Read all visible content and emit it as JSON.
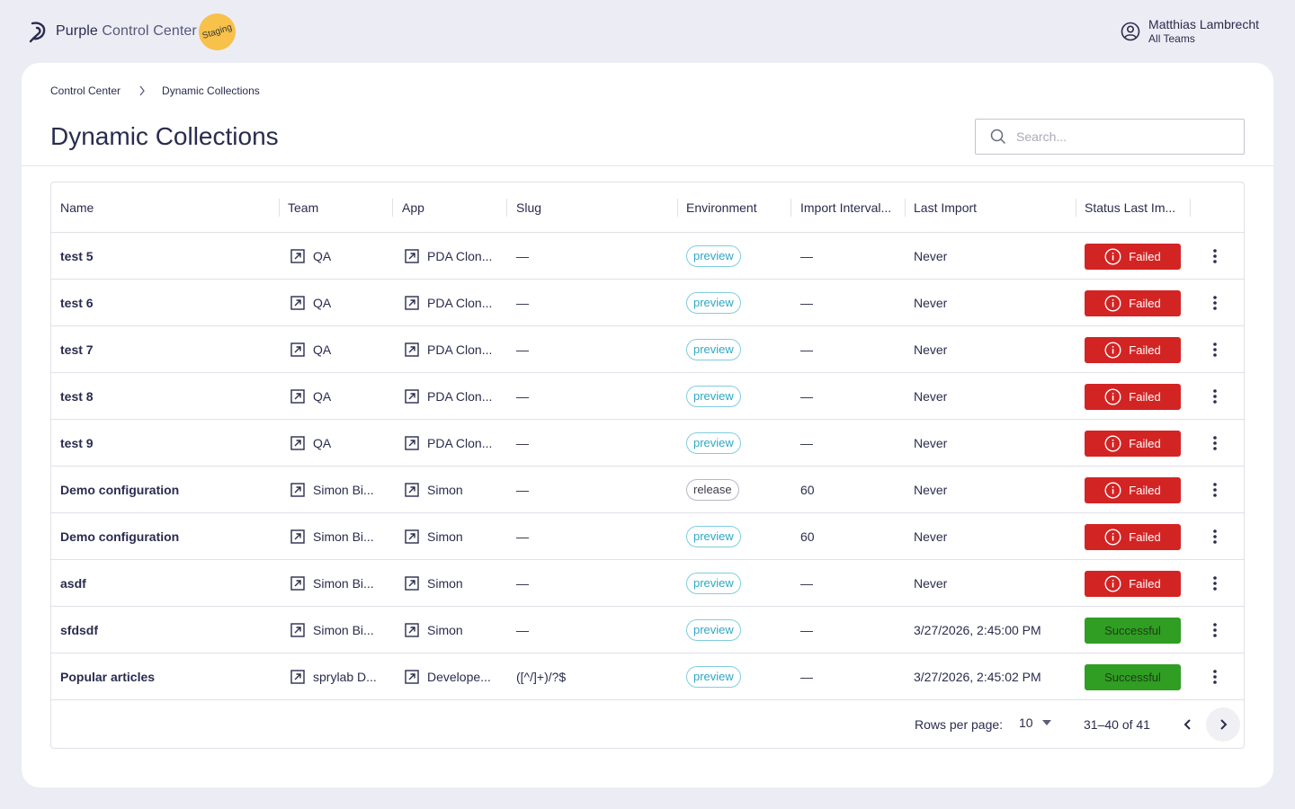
{
  "header": {
    "brand_strong": "Purple",
    "brand_light": "Control Center",
    "env_badge": "Staging",
    "user_name": "Matthias Lambrecht",
    "user_team": "All Teams"
  },
  "breadcrumb": {
    "root": "Control Center",
    "current": "Dynamic Collections"
  },
  "page": {
    "title": "Dynamic Collections",
    "search_placeholder": "Search..."
  },
  "table": {
    "columns": [
      "Name",
      "Team",
      "App",
      "Slug",
      "Environment",
      "Import Interval...",
      "Last Import",
      "Status Last Im..."
    ],
    "rows": [
      {
        "name": "test 5",
        "team": "QA",
        "app": "PDA Clon...",
        "slug": "—",
        "env": "preview",
        "interval": "—",
        "last": "Never",
        "status": "Failed"
      },
      {
        "name": "test 6",
        "team": "QA",
        "app": "PDA Clon...",
        "slug": "—",
        "env": "preview",
        "interval": "—",
        "last": "Never",
        "status": "Failed"
      },
      {
        "name": "test 7",
        "team": "QA",
        "app": "PDA Clon...",
        "slug": "—",
        "env": "preview",
        "interval": "—",
        "last": "Never",
        "status": "Failed"
      },
      {
        "name": "test 8",
        "team": "QA",
        "app": "PDA Clon...",
        "slug": "—",
        "env": "preview",
        "interval": "—",
        "last": "Never",
        "status": "Failed"
      },
      {
        "name": "test 9",
        "team": "QA",
        "app": "PDA Clon...",
        "slug": "—",
        "env": "preview",
        "interval": "—",
        "last": "Never",
        "status": "Failed"
      },
      {
        "name": "Demo configuration",
        "team": "Simon Bi...",
        "app": "Simon",
        "slug": "—",
        "env": "release",
        "interval": "60",
        "last": "Never",
        "status": "Failed"
      },
      {
        "name": "Demo configuration",
        "team": "Simon Bi...",
        "app": "Simon",
        "slug": "—",
        "env": "preview",
        "interval": "60",
        "last": "Never",
        "status": "Failed"
      },
      {
        "name": "asdf",
        "team": "Simon Bi...",
        "app": "Simon",
        "slug": "—",
        "env": "preview",
        "interval": "—",
        "last": "Never",
        "status": "Failed"
      },
      {
        "name": "sfdsdf",
        "team": "Simon Bi...",
        "app": "Simon",
        "slug": "—",
        "env": "preview",
        "interval": "—",
        "last": "3/27/2026, 2:45:00 PM",
        "status": "Successful"
      },
      {
        "name": "Popular articles",
        "team": "sprylab D...",
        "app": "Develope...",
        "slug": "([^/]+)/?$",
        "env": "preview",
        "interval": "—",
        "last": "3/27/2026, 2:45:02 PM",
        "status": "Successful"
      }
    ]
  },
  "pagination": {
    "rows_per_page_label": "Rows per page:",
    "rows_per_page_value": "10",
    "range_text": "31–40 of 41"
  },
  "colors": {
    "failed": "#d32424",
    "successful": "#2f9e22",
    "preview_chip": "#2ea8c4",
    "staging_badge": "#f7c14a"
  }
}
